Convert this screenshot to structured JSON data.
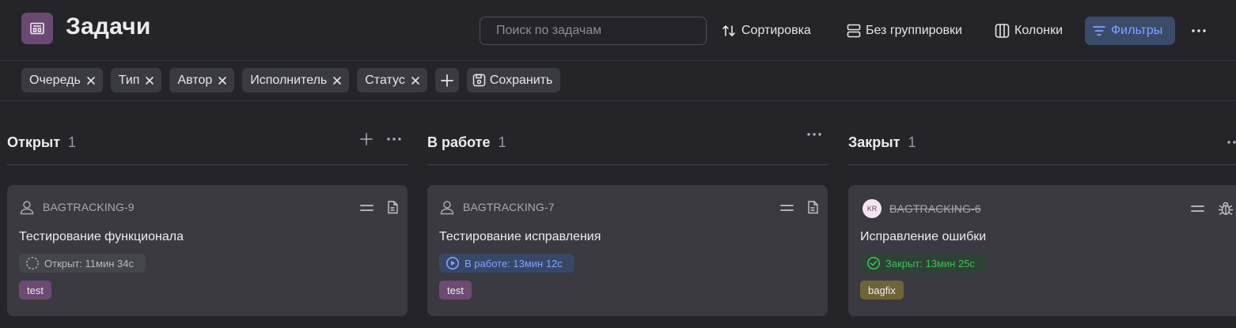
{
  "header": {
    "title": "Задачи",
    "app_icon": "board-icon",
    "search_placeholder": "Поиск по задачам",
    "sort_label": "Сортировка",
    "group_label": "Без группировки",
    "columns_label": "Колонки",
    "filters_label": "Фильтры",
    "more_icon": "more-horizontal-icon"
  },
  "filters": {
    "chips": [
      "Очередь",
      "Тип",
      "Автор",
      "Исполнитель",
      "Статус"
    ],
    "save_label": "Сохранить"
  },
  "columns": [
    {
      "title": "Открыт",
      "count": "1",
      "card": {
        "key": "BAGTRACKING-9",
        "title": "Тестирование функционала",
        "status_text": "Открыт: 11мин 34с",
        "tag": "test",
        "type_icon": "document-icon",
        "priority_icon": "priority-normal-icon"
      }
    },
    {
      "title": "В работе",
      "count": "1",
      "card": {
        "key": "BAGTRACKING-7",
        "title": "Тестирование исправления",
        "status_text": "В работе: 13мин 12с",
        "tag": "test",
        "type_icon": "document-icon",
        "priority_icon": "priority-normal-icon"
      }
    },
    {
      "title": "Закрыт",
      "count": "1",
      "card": {
        "key": "BAGTRACKING-6",
        "title": "Исправление ошибки",
        "status_text": "Закрыт: 13мин 25с",
        "tag": "bagfix",
        "avatar": "KR",
        "type_icon": "bug-icon",
        "priority_icon": "priority-normal-icon"
      }
    }
  ],
  "colors": {
    "background": "#252429",
    "card": "#3a3a40",
    "accent_blue": "#7ea5ff",
    "status_green": "#3fbf5a",
    "tag_purple": "#6d4a72",
    "tag_olive": "#6f6437"
  }
}
